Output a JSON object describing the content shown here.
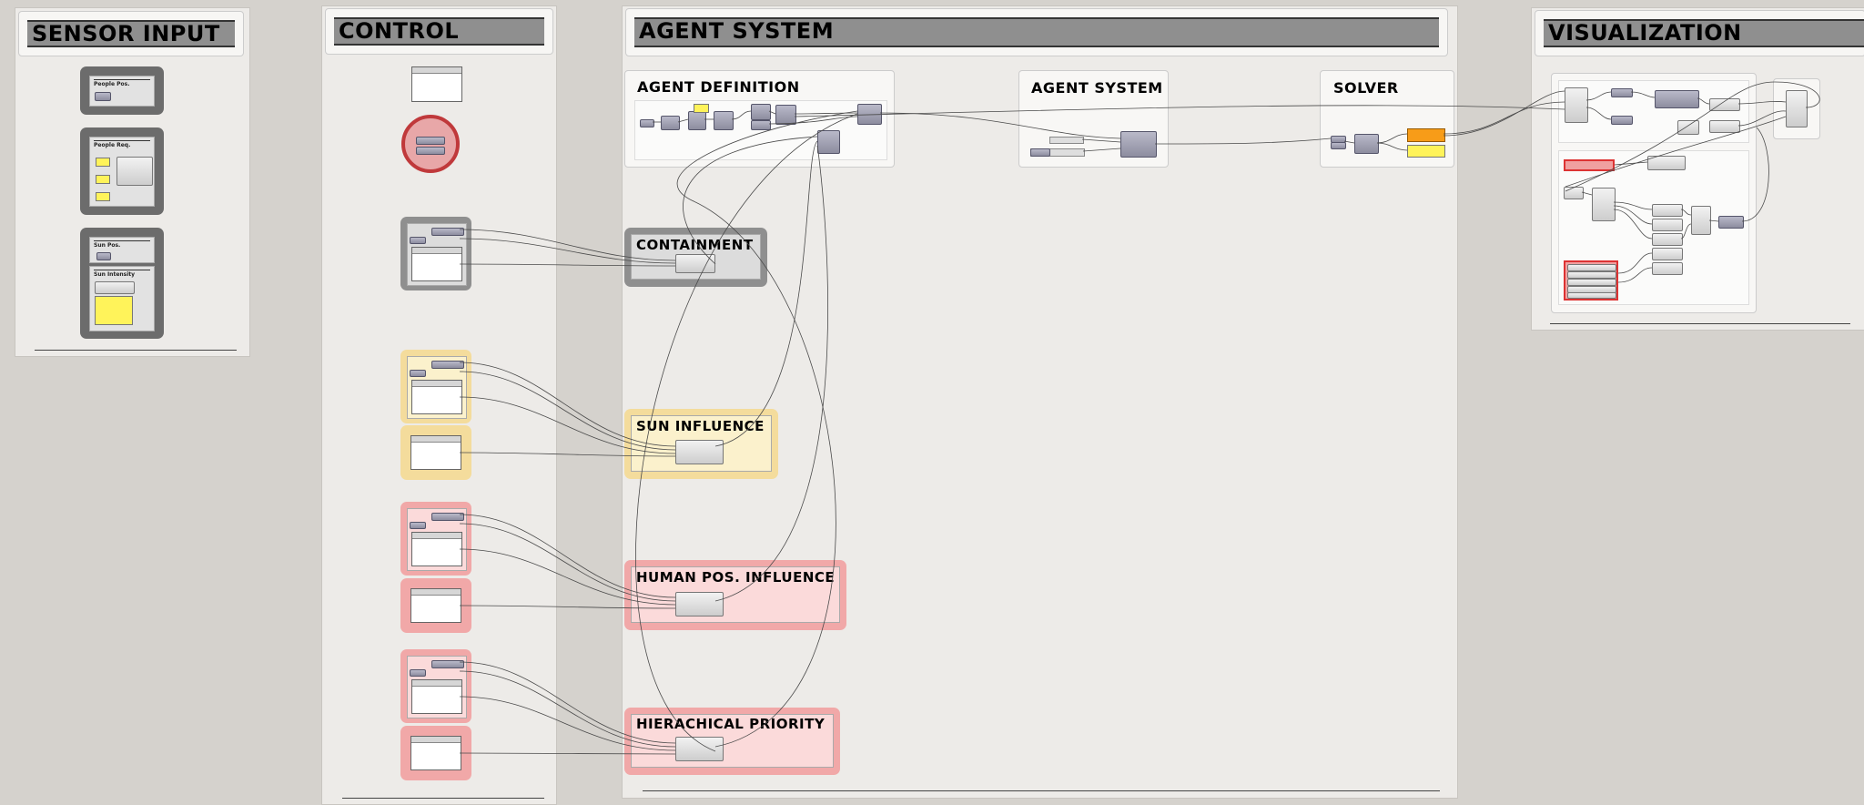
{
  "panels": {
    "sensor_input": "SENSOR INPUT",
    "control": "CONTROL",
    "agent_system": "AGENT SYSTEM",
    "visualization": "VISUALIZATION"
  },
  "sensor_groups": {
    "people_pos": "People Pos.",
    "people_req": "People Req.",
    "sun_pos": "Sun Pos.",
    "sun_intensity": "Sun Intensity"
  },
  "agent_subsections": {
    "agent_definition": "AGENT DEFINITION",
    "agent_system": "AGENT SYSTEM",
    "solver": "SOLVER"
  },
  "behaviors": {
    "containment": "CONTAINMENT",
    "sun_influence": "SUN INFLUENCE",
    "human_pos_influence": "HUMAN POS. INFLUENCE",
    "hierarchical_priority": "HIERACHICAL PRIORITY"
  },
  "colors": {
    "canvas": "#d5d2cd",
    "panel": "#edebe8",
    "title_bar": "#8f8f8f",
    "group_dark": "#6c6c6c",
    "group_yellow": "#f4dc9c",
    "group_red": "#f1a8a8",
    "toggle_red": "#c0393b",
    "component": "#9a9aac",
    "yellow_output": "#fff35a",
    "orange_output": "#f79c18"
  }
}
